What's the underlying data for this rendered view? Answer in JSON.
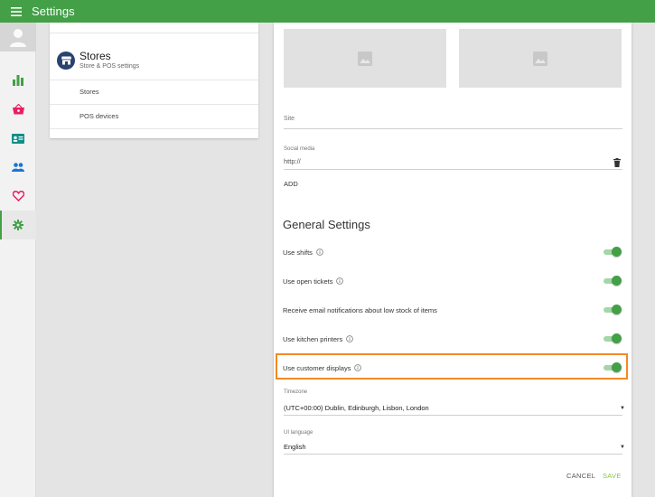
{
  "appbar": {
    "title": "Settings",
    "menu_icon": "hamburger-menu-icon"
  },
  "rail": {
    "items": [
      {
        "name": "reports",
        "icon": "bar-chart-icon"
      },
      {
        "name": "sales",
        "icon": "basket-icon"
      },
      {
        "name": "items",
        "icon": "contact-card-icon"
      },
      {
        "name": "employees",
        "icon": "people-icon"
      },
      {
        "name": "customers",
        "icon": "heart-icon"
      },
      {
        "name": "settings",
        "icon": "gear-icon",
        "active": true
      }
    ]
  },
  "stores_card": {
    "title": "Stores",
    "subtitle": "Store & POS settings",
    "links": [
      "Stores",
      "POS devices"
    ]
  },
  "panel": {
    "site": {
      "label": "Site"
    },
    "social": {
      "label": "Social media",
      "value": "http://"
    },
    "add_label": "ADD",
    "section_title": "General Settings",
    "settings": [
      {
        "label": "Use shifts",
        "info": true,
        "enabled": true
      },
      {
        "label": "Use open tickets",
        "info": true,
        "enabled": true
      },
      {
        "label": "Receive email notifications about low stock of items",
        "info": false,
        "enabled": true
      },
      {
        "label": "Use kitchen printers",
        "info": true,
        "enabled": true
      },
      {
        "label": "Use customer displays",
        "info": true,
        "enabled": true,
        "highlighted": true
      }
    ],
    "timezone": {
      "label": "Timezone",
      "value": "(UTC+00:00) Dublin, Edinburgh, Lisbon, London"
    },
    "language": {
      "label": "UI language",
      "value": "English"
    },
    "cancel_label": "CANCEL",
    "save_label": "SAVE"
  },
  "colors": {
    "appbar": "#43a047",
    "toggle_on": "#43a047",
    "highlight": "#f28a25",
    "save": "#8bc34a"
  }
}
